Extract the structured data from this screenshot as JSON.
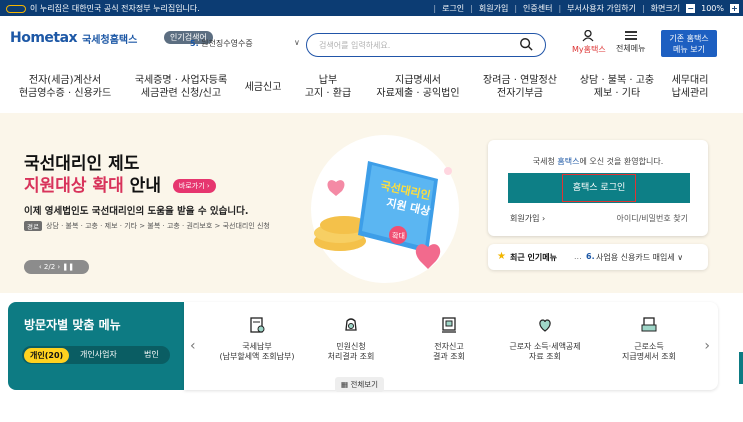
{
  "topbar": {
    "gov_notice": "이 누리집은 대한민국 공식 전자정부 누리집입니다.",
    "links": [
      "로그인",
      "회원가입",
      "인증센터",
      "부서사용자 가입하기",
      "화면크기"
    ],
    "zoom": "100%",
    "zoom_minus": "−",
    "zoom_plus": "+"
  },
  "header": {
    "logo_main": "Hometax",
    "logo_sub": "국세청홈택스",
    "popular_tag": "인기검색어",
    "popular_rank": "5.",
    "popular_term": "원천징수영수증",
    "search_placeholder": "검색어를 입력하세요.",
    "my_hometax": "My홈택스",
    "all_menu": "전체메뉴",
    "basic_hometax_line1": "기존 홈택스",
    "basic_hometax_line2": "메뉴 보기"
  },
  "gnb": [
    {
      "line1": "전자(세금)계산서",
      "line2": "현금영수증 · 신용카드"
    },
    {
      "line1": "국세증명 · 사업자등록",
      "line2": "세금관련 신청/신고"
    },
    {
      "line1": "세금신고",
      "line2": ""
    },
    {
      "line1": "납부",
      "line2": "고지 · 환급"
    },
    {
      "line1": "지급명세서",
      "line2": "자료제출 · 공익법인"
    },
    {
      "line1": "장려금 · 연말정산",
      "line2": "전자기부금"
    },
    {
      "line1": "상담 · 불복 · 고충",
      "line2": "제보 · 기타"
    },
    {
      "line1": "세무대리",
      "line2": "납세관리"
    }
  ],
  "hero": {
    "title1": "국선대리인 제도",
    "title2_highlight": "지원대상 확대",
    "title2_rest": " 안내",
    "shortcut": "바로가기 ›",
    "desc": "이제 영세법인도 국선대리인의 도움을 받을 수 있습니다.",
    "route_badge": "경로",
    "route": "상담 · 불복 · 고충 · 제보 · 기타 > 불복 · 고충 · 권리보호 > 국선대리인 신청",
    "pager": "‹  2/2  ›   ❚❚",
    "book_title1": "국선대리인",
    "book_title2": "지원 대상",
    "book_badge": "확대"
  },
  "login": {
    "welcome_pre": "국세청 ",
    "welcome_brand": "홈택스",
    "welcome_post": "에 오신 것을 환영합니다.",
    "button": "홈택스 로그인",
    "join": "회원가입 ›",
    "find": "아이디/비밀번호 찾기"
  },
  "popular_menu": {
    "label": "최근 인기메뉴",
    "dots": "...",
    "num": "6.",
    "text": "사업용 신용카드 매입세 ∨"
  },
  "visitor": {
    "title": "방문자별 맞춤 메뉴",
    "tabs": [
      "개인(20)",
      "개인사업자",
      "법인"
    ]
  },
  "quick_menu": [
    {
      "line1": "국세납부",
      "line2": "(납부할세액 조회납부)",
      "icon": "tax-payment-icon"
    },
    {
      "line1": "민원신청",
      "line2": "처리결과 조회",
      "icon": "civil-request-icon"
    },
    {
      "line1": "전자신고",
      "line2": "결과 조회",
      "icon": "e-filing-icon"
    },
    {
      "line1": "근로자 소득·세액공제",
      "line2": "자료 조회",
      "icon": "deduction-icon"
    },
    {
      "line1": "근로소득",
      "line2": "지급명세서 조회",
      "icon": "payslip-icon"
    }
  ],
  "quick_all": "▦ 전체보기",
  "colors": {
    "primary": "#0c3c73",
    "teal": "#0d7b83",
    "accent_pink": "#d8335b",
    "hero_bg": "#fbf6ea"
  }
}
